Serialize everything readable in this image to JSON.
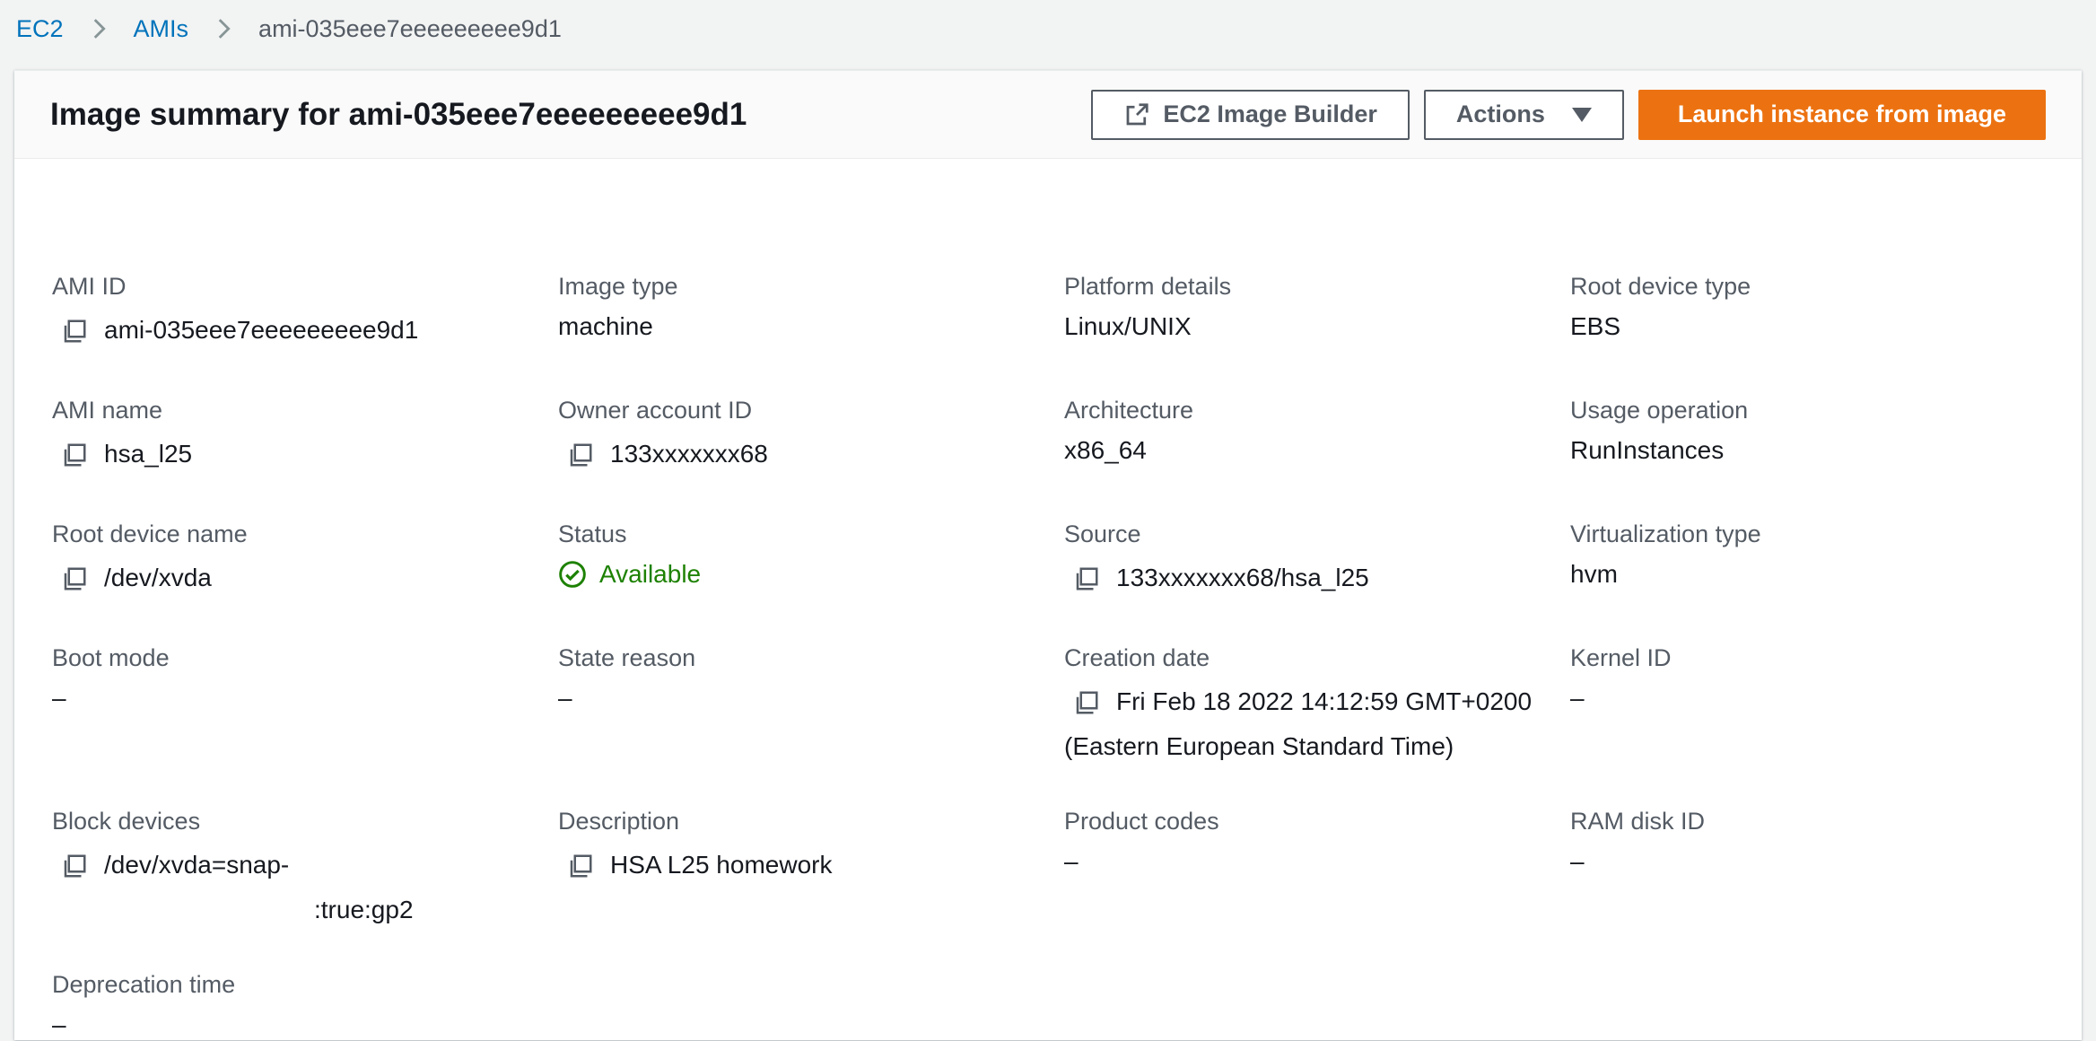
{
  "breadcrumb": {
    "items": [
      {
        "label": "EC2",
        "link": true
      },
      {
        "label": "AMIs",
        "link": true
      },
      {
        "label": "ami-035eee7eeeeeeeee9d1",
        "link": false
      }
    ]
  },
  "header": {
    "title": "Image summary for ami-035eee7eeeeeeeee9d1",
    "builder_label": "EC2 Image Builder",
    "actions_label": "Actions",
    "launch_label": "Launch instance from image"
  },
  "fields": {
    "ami_id": {
      "label": "AMI ID",
      "value": "ami-035eee7eeeeeeeee9d1"
    },
    "image_type": {
      "label": "Image type",
      "value": "machine"
    },
    "platform_details": {
      "label": "Platform details",
      "value": "Linux/UNIX"
    },
    "root_device_type": {
      "label": "Root device type",
      "value": "EBS"
    },
    "ami_name": {
      "label": "AMI name",
      "value": "hsa_l25"
    },
    "owner_account_id": {
      "label": "Owner account ID",
      "value": "133xxxxxxx68"
    },
    "architecture": {
      "label": "Architecture",
      "value": "x86_64"
    },
    "usage_operation": {
      "label": "Usage operation",
      "value": "RunInstances"
    },
    "root_device_name": {
      "label": "Root device name",
      "value": "/dev/xvda"
    },
    "status": {
      "label": "Status",
      "value": "Available",
      "color": "#1d8102"
    },
    "source": {
      "label": "Source",
      "value": "133xxxxxxx68/hsa_l25"
    },
    "virtualization_type": {
      "label": "Virtualization type",
      "value": "hvm"
    },
    "boot_mode": {
      "label": "Boot mode",
      "value": "–"
    },
    "state_reason": {
      "label": "State reason",
      "value": "–"
    },
    "creation_date": {
      "label": "Creation date",
      "value_line1": "Fri Feb 18 2022 14:12:59 GMT+0200",
      "value_line2": "(Eastern European Standard Time)"
    },
    "kernel_id": {
      "label": "Kernel ID",
      "value": "–"
    },
    "block_devices": {
      "label": "Block devices",
      "value_line1": "/dev/xvda=snap-",
      "value_line2": ":true:gp2"
    },
    "description": {
      "label": "Description",
      "value": "HSA L25 homework"
    },
    "product_codes": {
      "label": "Product codes",
      "value": "–"
    },
    "ram_disk_id": {
      "label": "RAM disk ID",
      "value": "–"
    },
    "deprecation_time": {
      "label": "Deprecation time",
      "value": "–"
    }
  },
  "colors": {
    "link": "#0073bb",
    "primary_button": "#ec7211",
    "label": "#545b64",
    "success": "#1d8102"
  },
  "icons": [
    "chevron-right-icon",
    "external-link-icon",
    "caret-down-icon",
    "copy-icon",
    "check-circle-icon"
  ]
}
